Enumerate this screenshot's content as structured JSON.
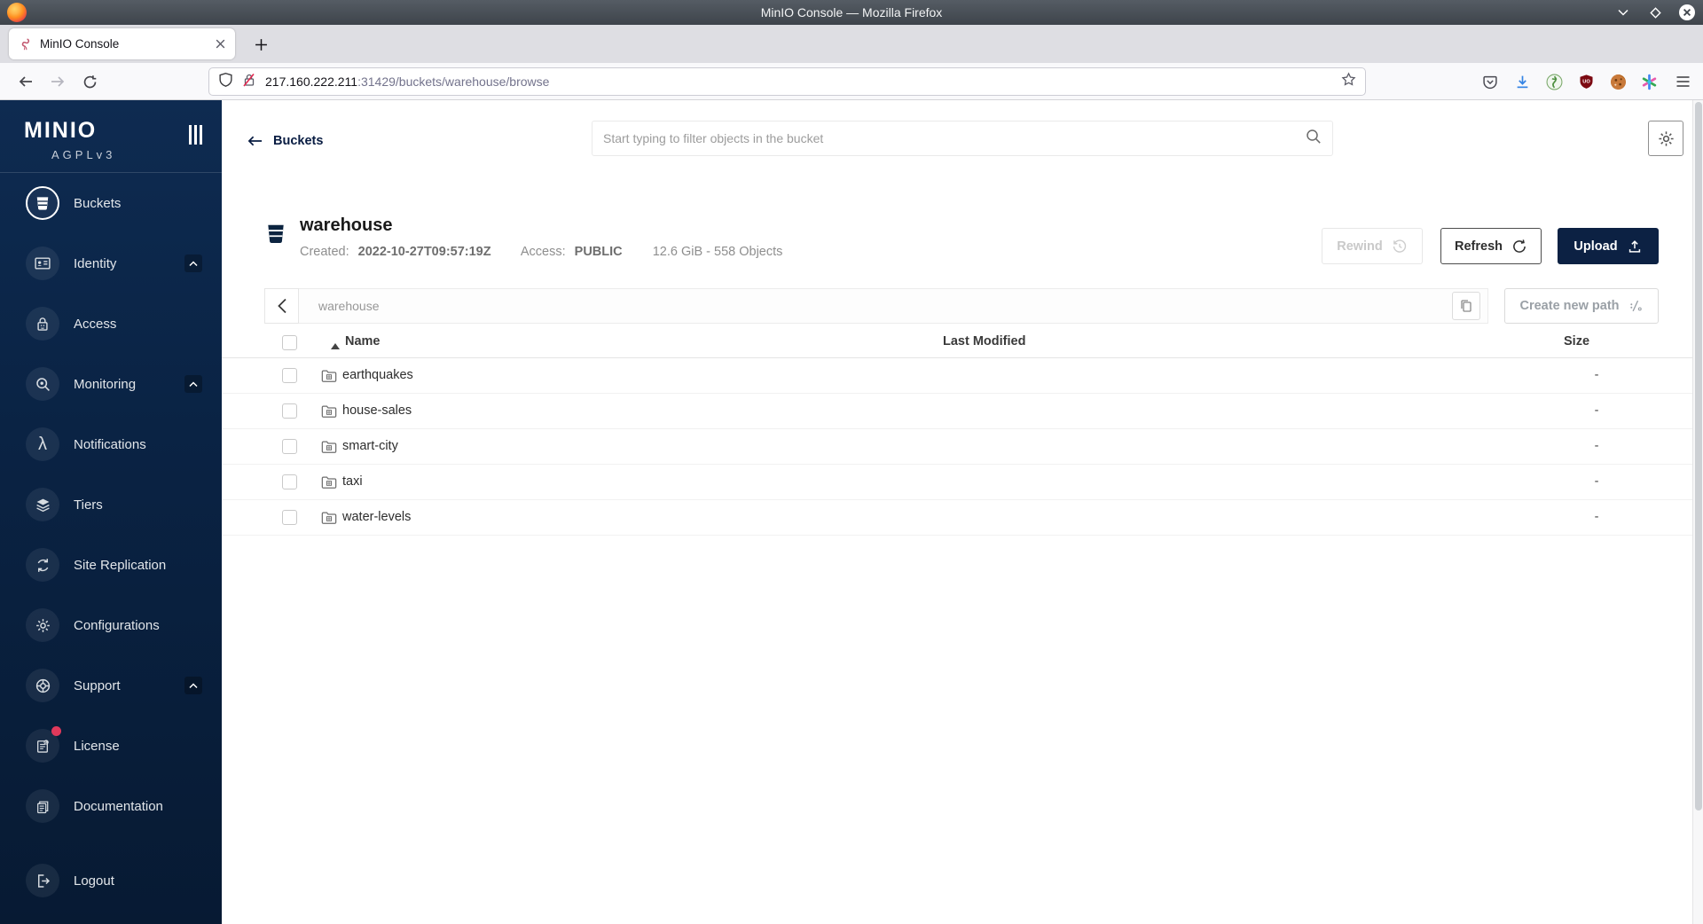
{
  "window": {
    "title": "MinIO Console — Mozilla Firefox"
  },
  "browser": {
    "tab_title": "MinIO Console",
    "url_host": "217.160.222.211",
    "url_rest": ":31429/buckets/warehouse/browse"
  },
  "sidebar": {
    "logo": "MINIO",
    "license_edition": "AGPLv3",
    "items": [
      {
        "label": "Buckets"
      },
      {
        "label": "Identity"
      },
      {
        "label": "Access"
      },
      {
        "label": "Monitoring"
      },
      {
        "label": "Notifications"
      },
      {
        "label": "Tiers"
      },
      {
        "label": "Site Replication"
      },
      {
        "label": "Configurations"
      },
      {
        "label": "Support"
      },
      {
        "label": "License"
      },
      {
        "label": "Documentation"
      },
      {
        "label": "Logout"
      }
    ]
  },
  "header": {
    "back_label": "Buckets",
    "search_placeholder": "Start typing to filter objects in the bucket"
  },
  "bucket": {
    "name": "warehouse",
    "created_label": "Created:",
    "created_value": "2022-10-27T09:57:19Z",
    "access_label": "Access:",
    "access_value": "PUBLIC",
    "usage": "12.6 GiB - 558 Objects",
    "rewind_label": "Rewind",
    "refresh_label": "Refresh",
    "upload_label": "Upload"
  },
  "pathbar": {
    "current_path": "warehouse",
    "create_button_label": "Create new path"
  },
  "table": {
    "columns": {
      "name": "Name",
      "modified": "Last Modified",
      "size": "Size"
    },
    "rows": [
      {
        "name": "earthquakes",
        "size": "-"
      },
      {
        "name": "house-sales",
        "size": "-"
      },
      {
        "name": "smart-city",
        "size": "-"
      },
      {
        "name": "taxi",
        "size": "-"
      },
      {
        "name": "water-levels",
        "size": "-"
      }
    ]
  },
  "icons": {
    "lambda": "λ"
  },
  "colors": {
    "accent_navy": "#081C42",
    "upload_button": "#0c2143",
    "license_dot": "#E0395B",
    "download_blue": "#3584E4"
  }
}
